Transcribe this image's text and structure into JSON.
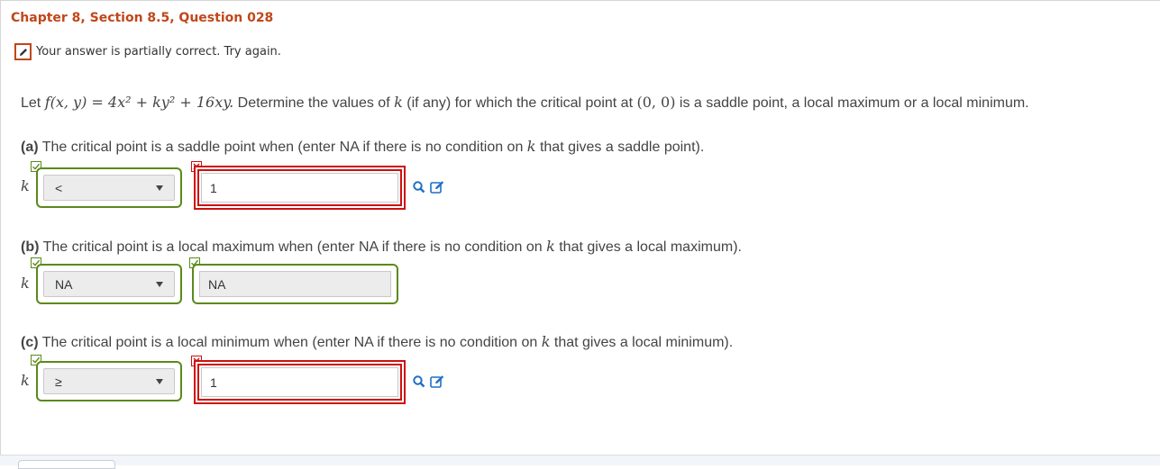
{
  "header": {
    "title": "Chapter 8, Section 8.5, Question 028"
  },
  "status": {
    "message": "Your answer is partially correct.  Try again.",
    "icon": "pencil-icon"
  },
  "question": {
    "prefix": "Let ",
    "function": "f(x, y) = 4x² + ky² + 16xy.",
    "middle": " Determine the values of ",
    "kvar": "k",
    "after_k": " (if any) for which the critical point at ",
    "point": "(0, 0)",
    "suffix": " is a saddle point, a local maximum or a local minimum."
  },
  "parts": [
    {
      "label": "(a)",
      "text_before_k": " The critical point is a saddle point when (enter NA if there is no condition on ",
      "text_after_k": " that gives a saddle point).",
      "kvar": "k",
      "select_value": "<",
      "select_status": "correct",
      "input_value": "1",
      "input_status": "incorrect"
    },
    {
      "label": "(b)",
      "text_before_k": " The critical point is a  local maximum when (enter NA if there is no condition on ",
      "text_after_k": " that gives a local maximum).",
      "kvar": "k",
      "select_value": "NA",
      "select_status": "correct",
      "input_value": "NA",
      "input_status": "correct"
    },
    {
      "label": "(c)",
      "text_before_k": "  The critical point is a local minimum when (enter NA if there is no condition on ",
      "text_after_k": " that gives a local minimum).",
      "kvar": "k",
      "select_value": "≥",
      "select_status": "correct",
      "input_value": "1",
      "input_status": "incorrect"
    }
  ],
  "colors": {
    "title": "#c0471a",
    "correct_border": "#5a8a1a",
    "incorrect_border": "#cc1111",
    "tool_icon": "#1f6fc5"
  }
}
